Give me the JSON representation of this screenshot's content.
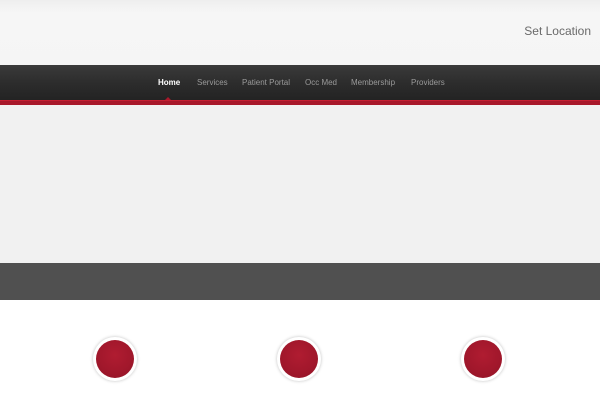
{
  "header": {
    "set_location_label": "Set Location"
  },
  "nav": {
    "items": [
      {
        "label": "Home",
        "active": true
      },
      {
        "label": "Services",
        "active": false
      },
      {
        "label": "Patient Portal",
        "active": false
      },
      {
        "label": "Occ Med",
        "active": false
      },
      {
        "label": "Membership",
        "active": false
      },
      {
        "label": "Providers",
        "active": false
      }
    ]
  },
  "colors": {
    "accent_red": "#a8182a",
    "nav_background": "#2d2d2d",
    "dark_band": "#505050",
    "hero_background": "#f1f1f1"
  }
}
